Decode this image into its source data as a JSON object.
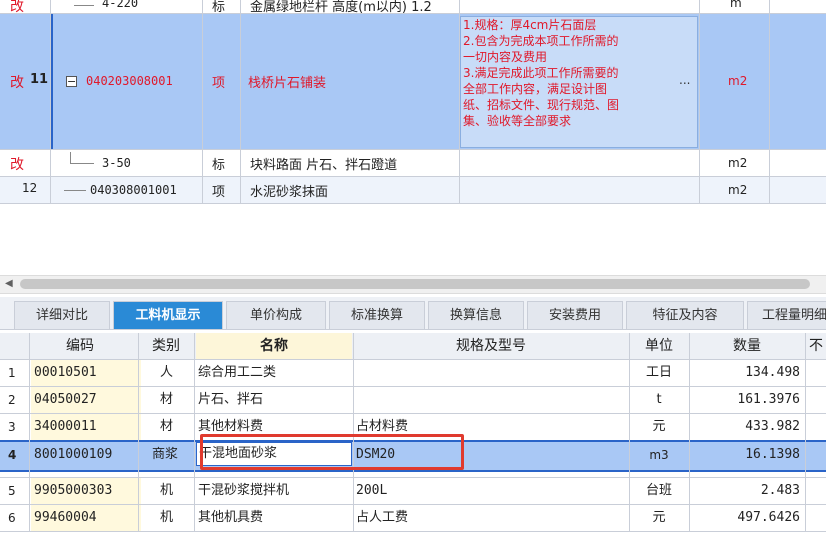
{
  "top_table": {
    "rows": [
      {
        "mark": "改",
        "num": "",
        "code": "4-220",
        "type": "标",
        "name": "金属绿地栏杆 高度(m以内) 1.2",
        "spec": "",
        "unit": "m"
      },
      {
        "mark": "改",
        "num": "11",
        "code": "040203008001",
        "type": "项",
        "name": "栈桥片石铺装",
        "spec_lines": [
          "1.规格：厚4cm片石面层",
          "2.包含为完成本项工作所需的",
          "一切内容及费用",
          "3.满足完成此项工作所需要的",
          "全部工作内容，满足设计图",
          "纸、招标文件、现行规范、图",
          "集、验收等全部要求"
        ],
        "spec_more": "...",
        "unit": "m2"
      },
      {
        "mark": "改",
        "num": "",
        "code": "3-50",
        "type": "标",
        "name": "块料路面 片石、拌石蹬道",
        "spec": "",
        "unit": "m2"
      },
      {
        "mark": "",
        "num": "12",
        "code": "040308001001",
        "type": "项",
        "name": "水泥砂浆抹面",
        "spec": "",
        "unit": "m2"
      }
    ],
    "tree_toggle": "−"
  },
  "scrollbar": {
    "left_arrow": "◀"
  },
  "tabs": [
    {
      "label": "详细对比"
    },
    {
      "label": "工料机显示"
    },
    {
      "label": "单价构成"
    },
    {
      "label": "标准换算"
    },
    {
      "label": "换算信息"
    },
    {
      "label": "安装费用"
    },
    {
      "label": "特征及内容"
    },
    {
      "label": "工程量明细"
    }
  ],
  "active_tab": "工料机显示",
  "grid": {
    "headers": [
      "编码",
      "类别",
      "名称",
      "规格及型号",
      "单位",
      "数量",
      "不"
    ],
    "rows": [
      {
        "idx": "1",
        "code": "00010501",
        "cat": "人",
        "name": "综合用工二类",
        "spec": "",
        "unit": "工日",
        "qty": "134.498"
      },
      {
        "idx": "2",
        "code": "04050027",
        "cat": "材",
        "name": "片石、拌石",
        "spec": "",
        "unit": "t",
        "qty": "161.3976"
      },
      {
        "idx": "3",
        "code": "34000011",
        "cat": "材",
        "name": "其他材料费",
        "spec": "占材料费",
        "unit": "元",
        "qty": "433.982"
      },
      {
        "idx": "4",
        "code": "8001000109",
        "cat": "商浆",
        "name": "干混地面砂浆",
        "spec": "DSM20",
        "unit": "m3",
        "qty": "16.1398"
      },
      {
        "idx": "5",
        "code": "9905000303",
        "cat": "机",
        "name": "干混砂浆搅拌机",
        "spec": "200L",
        "unit": "台班",
        "qty": "2.483"
      },
      {
        "idx": "6",
        "code": "99460004",
        "cat": "机",
        "name": "其他机具费",
        "spec": "占人工费",
        "unit": "元",
        "qty": "497.6426"
      }
    ]
  },
  "colors": {
    "selected": "#a9c8f5",
    "active_tab": "#2a8ad6",
    "highlight_box": "#e03a2e",
    "red_text": "#e0182a"
  }
}
